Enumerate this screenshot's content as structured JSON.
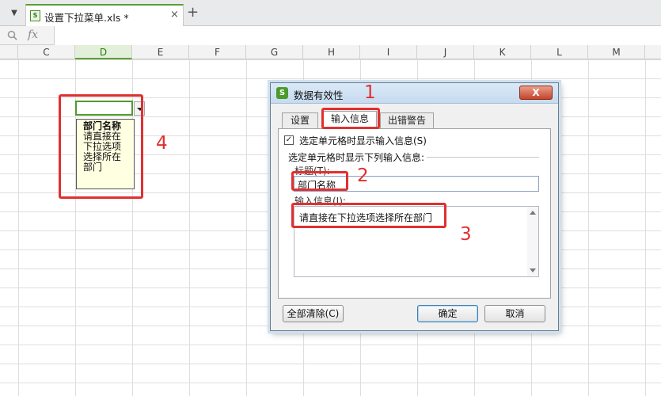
{
  "tab": {
    "title": "设置下拉菜单.xls *",
    "close": "×",
    "add": "+"
  },
  "formula_bar": {
    "fx": "fx"
  },
  "columns": [
    "C",
    "D",
    "E",
    "F",
    "G",
    "H",
    "I",
    "J",
    "K",
    "L",
    "M"
  ],
  "active_column": "D",
  "input_tip": {
    "title": "部门名称",
    "lines": [
      "请直接在",
      "下拉选项",
      "选择所在",
      "部门"
    ]
  },
  "dialog": {
    "title": "数据有效性",
    "close": "X",
    "tabs": [
      "设置",
      "输入信息",
      "出错警告"
    ],
    "selected_tab": "输入信息",
    "checkbox": {
      "checked": true,
      "mark": "✓",
      "label": "选定单元格时显示输入信息(S)"
    },
    "section_label": "选定单元格时显示下列输入信息:",
    "title_label": "标题(T):",
    "title_value": "部门名称",
    "message_label": "输入信息(I):",
    "message_value": "请直接在下拉选项选择所在部门",
    "buttons": {
      "clear_all": "全部清除(C)",
      "ok": "确定",
      "cancel": "取消"
    }
  },
  "annotations": [
    "1",
    "2",
    "3",
    "4"
  ],
  "colors": {
    "accent_green": "#5b9e3a",
    "annotation_red": "#e03030",
    "tip_bg": "#ffffe1"
  }
}
